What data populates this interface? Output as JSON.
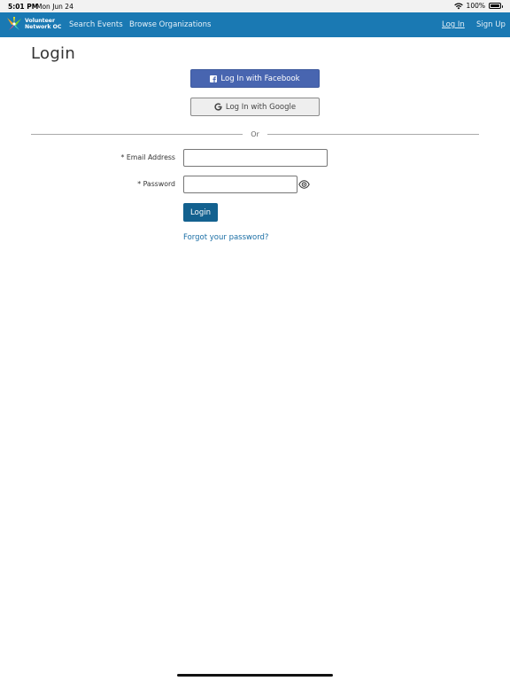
{
  "status_bar": {
    "time": "5:01 PM",
    "date": "Mon Jun 24",
    "battery_text": "100%",
    "battery_level": 1.0
  },
  "navbar": {
    "logo_line1": "Volunteer",
    "logo_line2": "Network OC",
    "search_events": "Search Events",
    "browse_organizations": "Browse Organizations",
    "log_in": "Log In",
    "sign_up": "Sign Up"
  },
  "page": {
    "title": "Login"
  },
  "social": {
    "facebook_label": "Log In with Facebook",
    "google_label": "Log In with Google"
  },
  "divider_text": "Or",
  "form": {
    "email_label": "* Email Address",
    "email_value": "",
    "password_label": "* Password",
    "password_value": "",
    "login_button": "Login",
    "forgot_link": "Forgot your password?"
  },
  "colors": {
    "nav_bg": "#1a79b3",
    "facebook": "#4865b0",
    "google_bg": "#eeeeee",
    "login_button": "#13618f",
    "link": "#1a6ea5"
  },
  "icons": [
    "wifi-icon",
    "battery-icon",
    "logo-icon",
    "facebook-icon",
    "google-icon",
    "eye-icon"
  ]
}
